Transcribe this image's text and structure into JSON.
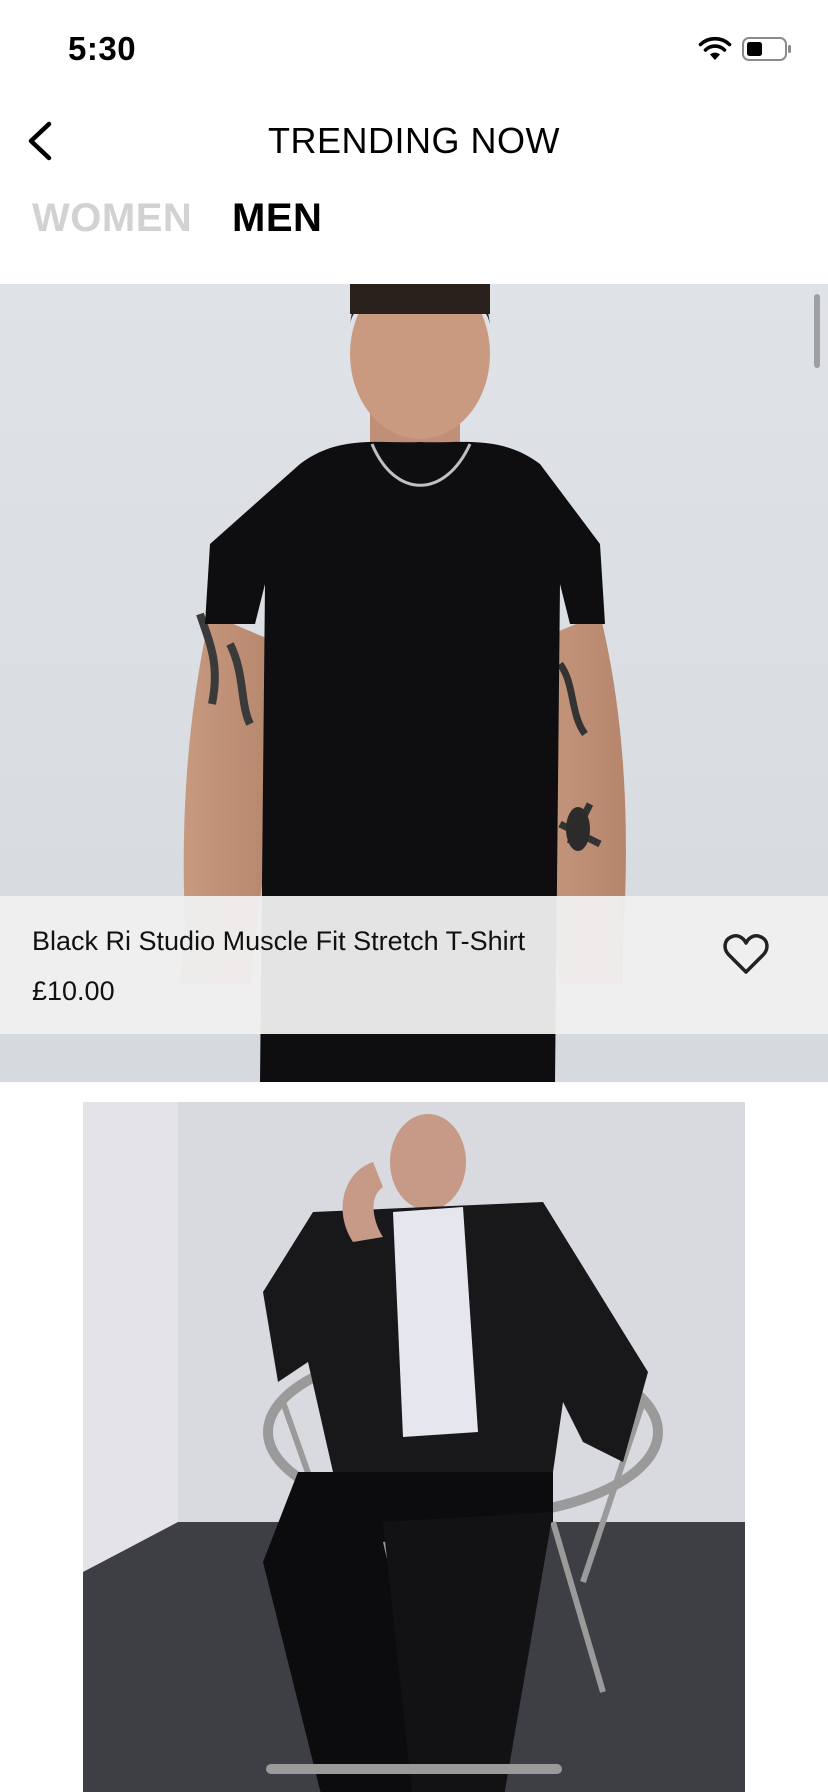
{
  "status_bar": {
    "time": "5:30",
    "wifi_icon": "wifi-icon",
    "battery_icon": "battery-icon"
  },
  "nav": {
    "back_icon": "chevron-left-icon",
    "title": "TRENDING NOW"
  },
  "tabs": [
    {
      "label": "WOMEN",
      "selected": false
    },
    {
      "label": "MEN",
      "selected": true
    }
  ],
  "products": [
    {
      "name": "Black Ri Studio Muscle Fit Stretch T-Shirt",
      "price": "£10.00",
      "favorite_icon": "heart-outline-icon"
    }
  ],
  "colors": {
    "tab_inactive": "#d2d2d2",
    "tab_active": "#000000",
    "info_panel": "#f0f0f0"
  }
}
